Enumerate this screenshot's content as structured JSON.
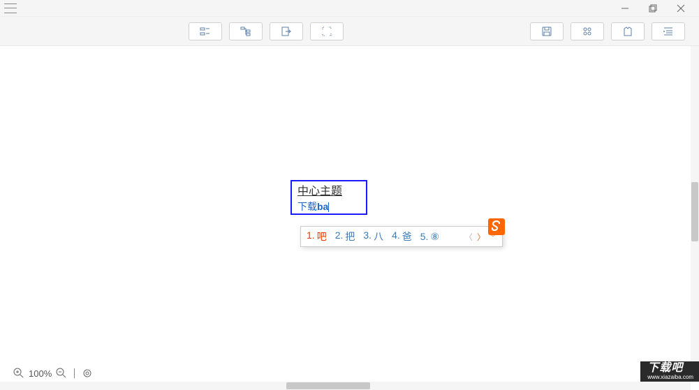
{
  "window": {
    "minimize": "minimize",
    "maximize": "maximize",
    "close": "close"
  },
  "toolbar": {
    "center_icons": [
      "insert-sibling",
      "insert-child",
      "export",
      "fit-selection"
    ],
    "right_icons": [
      "save",
      "view-grid",
      "theme",
      "outline"
    ]
  },
  "canvas": {
    "central_topic": "中心主题",
    "editing_prefix": "下载",
    "editing_comp": "ba"
  },
  "ime": {
    "candidates": [
      {
        "num": "1.",
        "ch": "吧"
      },
      {
        "num": "2.",
        "ch": "把"
      },
      {
        "num": "3.",
        "ch": "八"
      },
      {
        "num": "4.",
        "ch": "爸"
      },
      {
        "num": "5.",
        "ch": "⑧"
      }
    ]
  },
  "footer": {
    "zoom_level": "100%"
  },
  "watermark": {
    "title": "下载吧",
    "url": "www.xiazaiba.com"
  }
}
